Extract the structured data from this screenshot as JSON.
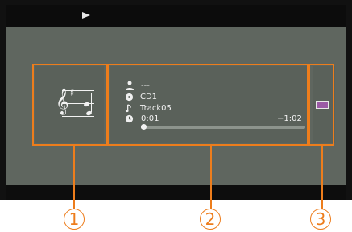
{
  "player": {
    "status_icon": "play-icon",
    "artist": "---",
    "album": "CD1",
    "track": "Track05",
    "time_elapsed": "0:01",
    "time_remaining": "−1:02",
    "progress_fraction": 0.02
  },
  "callouts": {
    "one": "1",
    "two": "2",
    "three": "3"
  },
  "colors": {
    "accent": "#ed7d1c",
    "panel": "#5f665f",
    "screen": "#111111"
  }
}
